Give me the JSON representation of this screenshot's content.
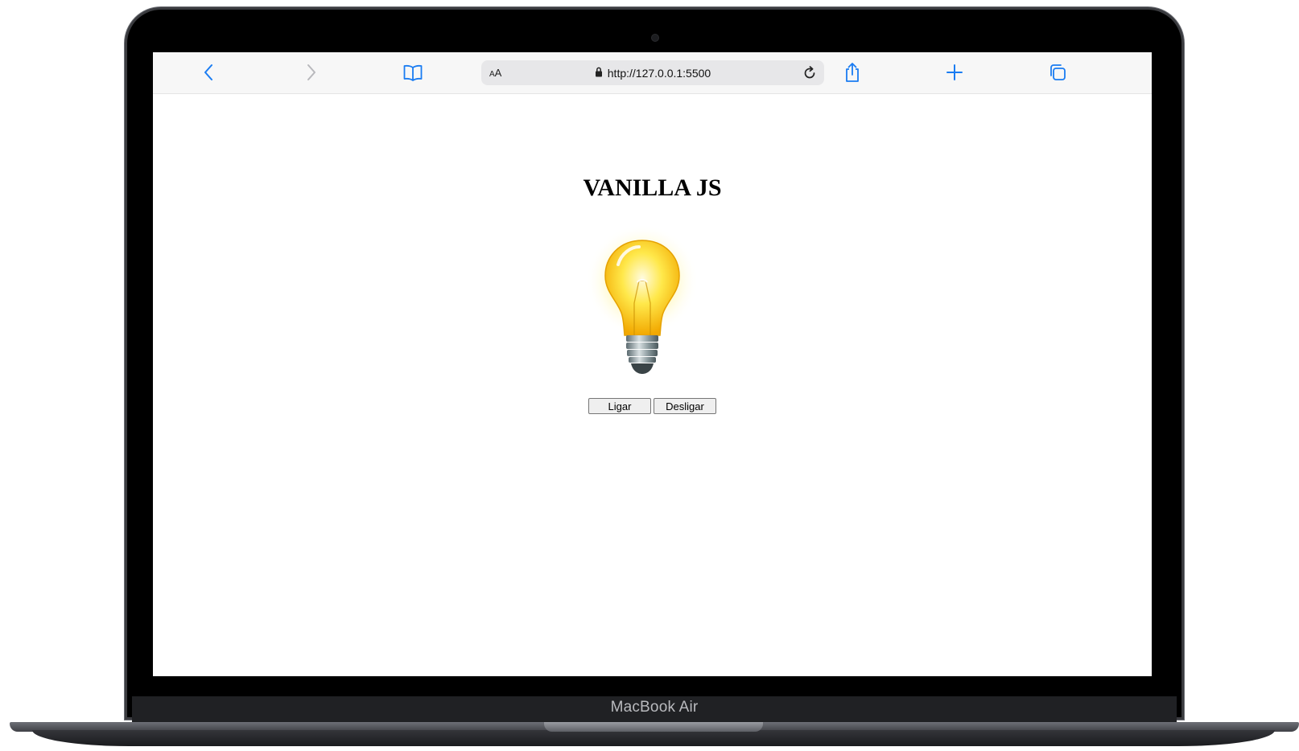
{
  "device": {
    "model_label": "MacBook Air"
  },
  "browser": {
    "aa_label_small": "A",
    "aa_label_large": "A",
    "url": "http://127.0.0.1:5500",
    "icons": {
      "back": "chevron-left-icon",
      "forward": "chevron-right-icon",
      "bookmarks": "book-icon",
      "lock": "lock-icon",
      "reload": "reload-icon",
      "share": "share-icon",
      "new_tab": "plus-icon",
      "tabs": "tabs-icon"
    },
    "accent_color": "#1a7cf2"
  },
  "page": {
    "title": "VANILLA JS",
    "bulb_state": "on",
    "buttons": {
      "on_label": "Ligar",
      "off_label": "Desligar"
    }
  }
}
